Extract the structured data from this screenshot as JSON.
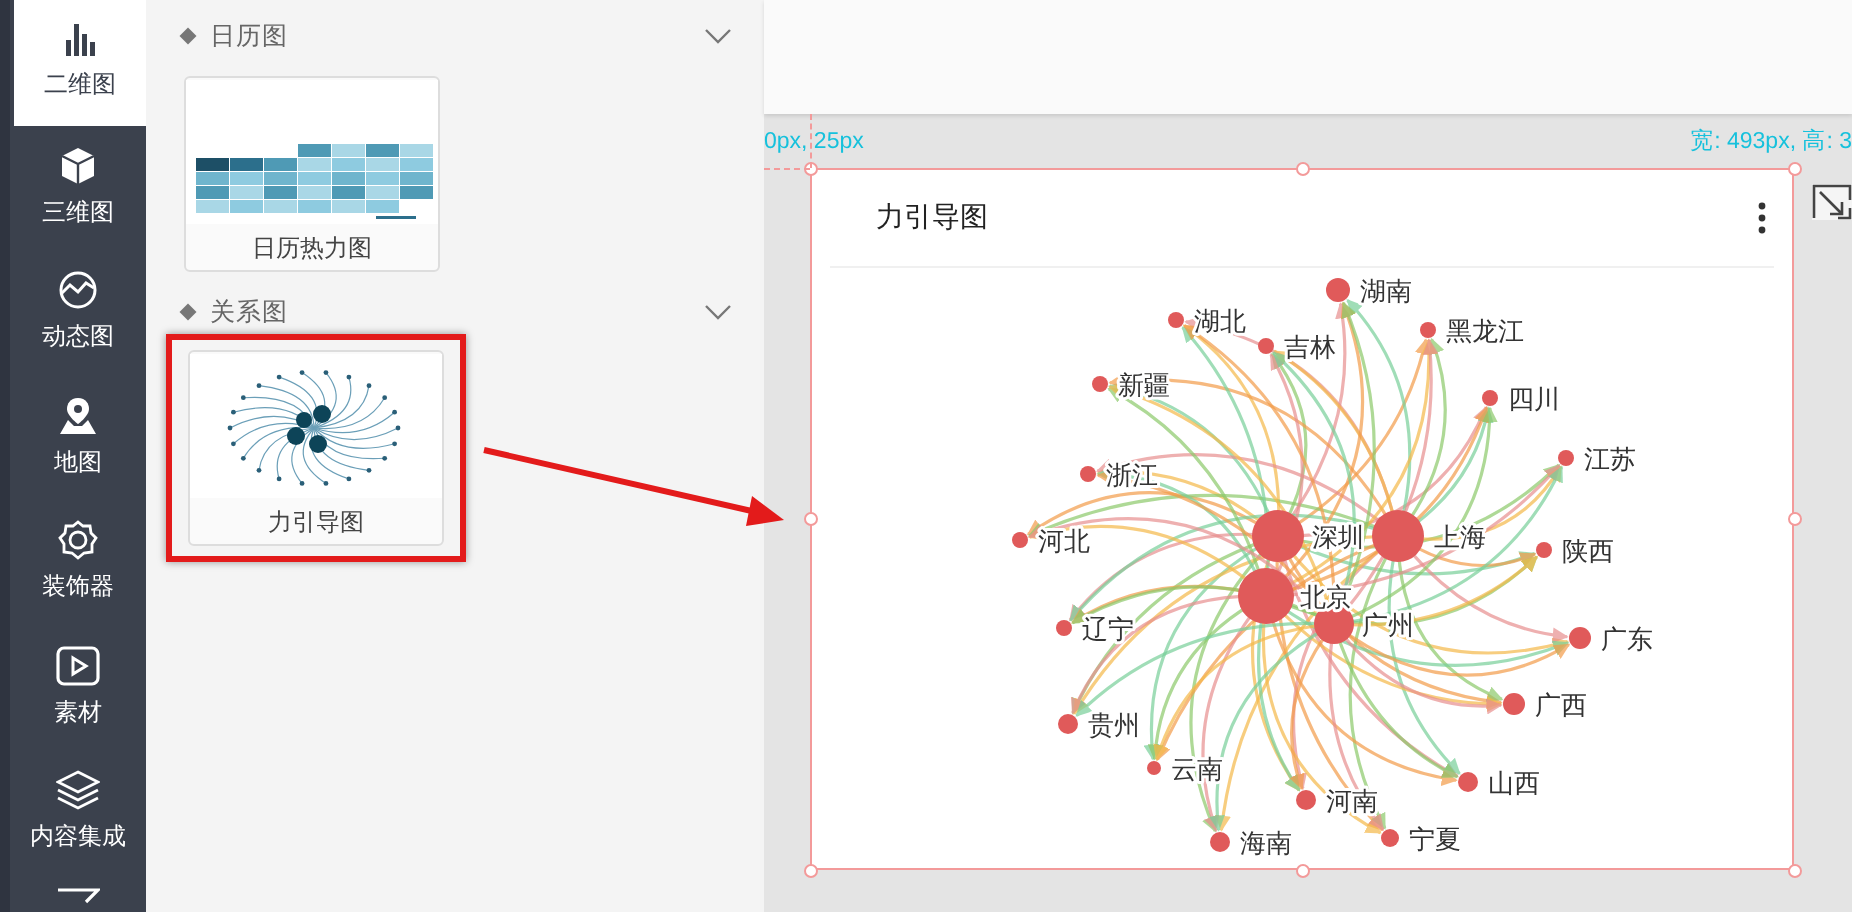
{
  "sidebar": {
    "items": [
      {
        "label": "二维图",
        "selected": true
      },
      {
        "label": "三维图",
        "selected": false
      },
      {
        "label": "动态图",
        "selected": false
      },
      {
        "label": "地图",
        "selected": false
      },
      {
        "label": "装饰器",
        "selected": false
      },
      {
        "label": "素材",
        "selected": false
      },
      {
        "label": "内容集成",
        "selected": false
      }
    ]
  },
  "panel": {
    "sections": [
      {
        "title": "日历图",
        "expanded": true,
        "cards": [
          {
            "label": "日历热力图",
            "kind": "calendar",
            "highlighted": false
          }
        ]
      },
      {
        "title": "关系图",
        "expanded": true,
        "cards": [
          {
            "label": "力引导图",
            "kind": "graph",
            "highlighted": true
          }
        ]
      }
    ]
  },
  "ruler": {
    "position": "0px, 25px",
    "size": "宽: 493px, 高: 3"
  },
  "chart": {
    "title": "力引导图",
    "nodes": [
      {
        "name": "湖南",
        "kind": "leaf"
      },
      {
        "name": "湖北",
        "kind": "leaf"
      },
      {
        "name": "吉林",
        "kind": "leaf"
      },
      {
        "name": "黑龙江",
        "kind": "leaf"
      },
      {
        "name": "新疆",
        "kind": "leaf"
      },
      {
        "name": "四川",
        "kind": "leaf"
      },
      {
        "name": "浙江",
        "kind": "leaf"
      },
      {
        "name": "江苏",
        "kind": "leaf"
      },
      {
        "name": "河北",
        "kind": "leaf"
      },
      {
        "name": "深圳",
        "kind": "hub"
      },
      {
        "name": "上海",
        "kind": "hub"
      },
      {
        "name": "陕西",
        "kind": "leaf"
      },
      {
        "name": "北京",
        "kind": "hub"
      },
      {
        "name": "辽宁",
        "kind": "leaf"
      },
      {
        "name": "广州",
        "kind": "hub"
      },
      {
        "name": "广东",
        "kind": "leaf"
      },
      {
        "name": "贵州",
        "kind": "leaf"
      },
      {
        "name": "广西",
        "kind": "leaf"
      },
      {
        "name": "云南",
        "kind": "leaf"
      },
      {
        "name": "山西",
        "kind": "leaf"
      },
      {
        "name": "河南",
        "kind": "leaf"
      },
      {
        "name": "海南",
        "kind": "leaf"
      },
      {
        "name": "宁夏",
        "kind": "leaf"
      }
    ]
  }
}
